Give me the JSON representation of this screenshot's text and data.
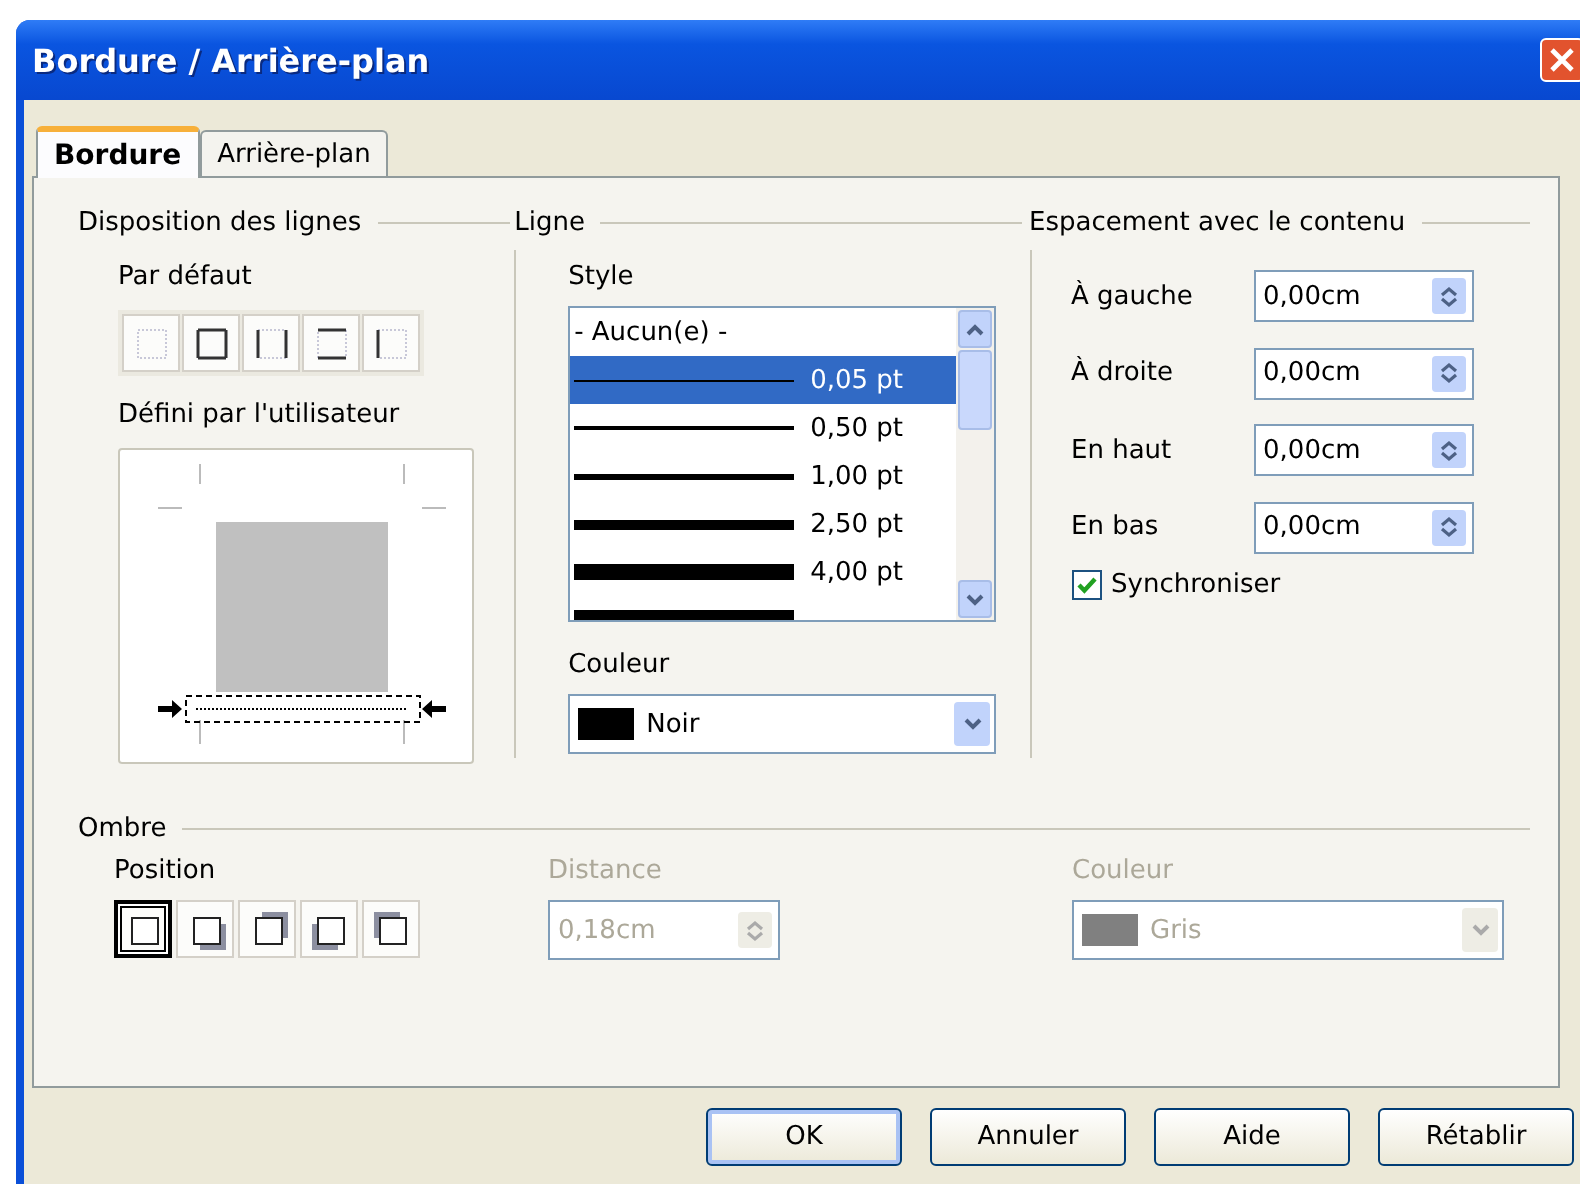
{
  "window": {
    "title": "Bordure / Arrière-plan"
  },
  "tabs": [
    {
      "label": "Bordure",
      "selected": true
    },
    {
      "label": "Arrière-plan",
      "selected": false
    }
  ],
  "line_arrangement": {
    "legend": "Disposition des lignes",
    "default_label": "Par défaut",
    "presets": [
      {
        "kind": "none"
      },
      {
        "kind": "box"
      },
      {
        "kind": "sides"
      },
      {
        "kind": "topbottom"
      },
      {
        "kind": "left"
      }
    ],
    "user_label": "Défini par l'utilisateur"
  },
  "line": {
    "legend": "Ligne",
    "style_label": "Style",
    "styles": [
      {
        "kind": "none",
        "label": "- Aucun(e) -",
        "selected": false
      },
      {
        "kind": "hairline",
        "label": "0,05 pt",
        "selected": true
      },
      {
        "kind": "thin",
        "label": "0,50 pt",
        "selected": false
      },
      {
        "kind": "medium",
        "label": "1,00 pt",
        "selected": false
      },
      {
        "kind": "thick",
        "label": "2,50 pt",
        "selected": false
      },
      {
        "kind": "heavy",
        "label": "4,00 pt",
        "selected": false
      },
      {
        "kind": "extra",
        "selected": false
      }
    ],
    "color_label": "Couleur",
    "color": {
      "name": "Noir",
      "color": "#000000"
    }
  },
  "spacing": {
    "legend": "Espacement avec le contenu",
    "fields": [
      {
        "label": "À gauche",
        "value": "0,00cm"
      },
      {
        "label": "À droite",
        "value": "0,00cm"
      },
      {
        "label": "En haut",
        "value": "0,00cm"
      },
      {
        "label": "En bas",
        "value": "0,00cm"
      }
    ],
    "sync": {
      "label": "Synchroniser",
      "checked": true
    }
  },
  "shadow": {
    "legend": "Ombre",
    "position_label": "Position",
    "positions": [
      {
        "kind": "none",
        "selected": true
      },
      {
        "kind": "bottom-right",
        "selected": false
      },
      {
        "kind": "top-right",
        "selected": false
      },
      {
        "kind": "bottom-left",
        "selected": false
      },
      {
        "kind": "top-left",
        "selected": false
      }
    ],
    "distance": {
      "label": "Distance",
      "value": "0,18cm",
      "disabled": true
    },
    "color": {
      "label": "Couleur",
      "name": "Gris",
      "color": "#808080",
      "disabled": true
    }
  },
  "buttons": [
    "OK",
    "Annuler",
    "Aide",
    "Rétablir"
  ]
}
